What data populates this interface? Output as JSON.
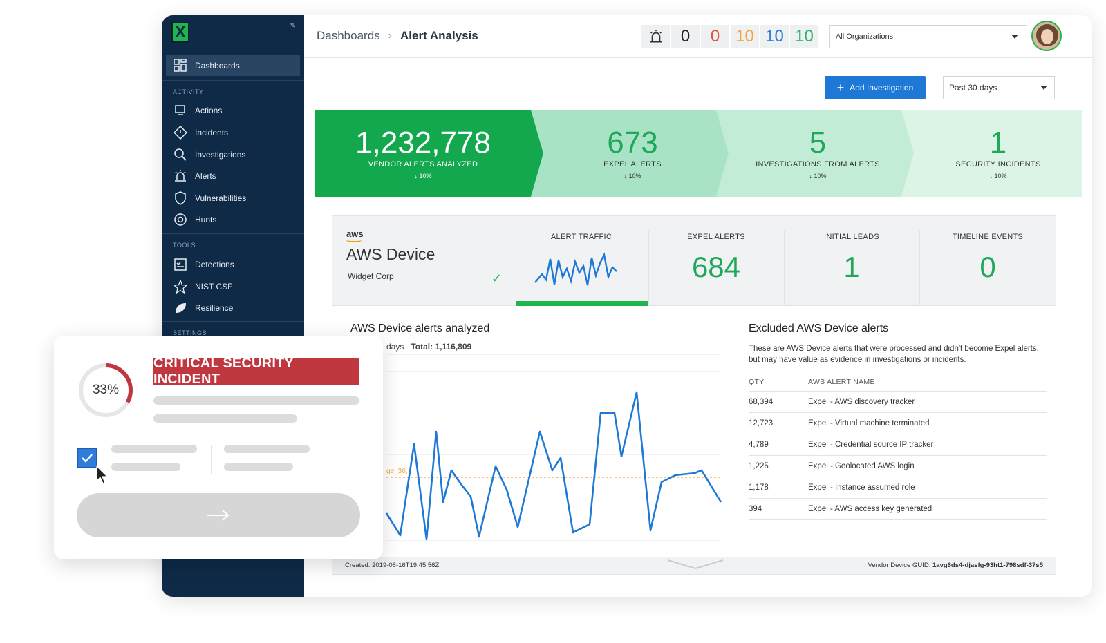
{
  "sidebar": {
    "active_item": {
      "label": "Dashboards",
      "icon": "dashboard-grid-icon"
    },
    "sections": [
      {
        "label": "ACTIVITY",
        "items": [
          {
            "label": "Actions",
            "icon": "actions-icon"
          },
          {
            "label": "Incidents",
            "icon": "incident-diamond-icon"
          },
          {
            "label": "Investigations",
            "icon": "investigations-magnifier-icon"
          },
          {
            "label": "Alerts",
            "icon": "alert-siren-icon"
          },
          {
            "label": "Vulnerabilities",
            "icon": "vulnerability-shield-icon"
          },
          {
            "label": "Hunts",
            "icon": "hunts-target-icon"
          }
        ]
      },
      {
        "label": "TOOLS",
        "items": [
          {
            "label": "Detections",
            "icon": "detections-checklist-icon"
          },
          {
            "label": "NIST CSF",
            "icon": "nist-star-icon"
          },
          {
            "label": "Resilience",
            "icon": "resilience-leaf-icon"
          }
        ]
      },
      {
        "label": "SETTINGS",
        "items": []
      }
    ]
  },
  "header": {
    "breadcrumb": [
      "Dashboards",
      "Alert Analysis"
    ],
    "counters": [
      {
        "value": "0",
        "color": "#222222"
      },
      {
        "value": "0",
        "color": "#e0553b"
      },
      {
        "value": "10",
        "color": "#f0a53a"
      },
      {
        "value": "10",
        "color": "#2d7fd3"
      },
      {
        "value": "10",
        "color": "#2bb36b"
      }
    ],
    "org_select": "All Organizations"
  },
  "toolbar": {
    "add_investigation": "Add Investigation",
    "date_range": "Past 30 days"
  },
  "funnel": [
    {
      "value": "1,232,778",
      "label": "VENDOR ALERTS ANALYZED",
      "change": "10%"
    },
    {
      "value": "673",
      "label": "EXPEL ALERTS",
      "change": "10%"
    },
    {
      "value": "5",
      "label": "INVESTIGATIONS FROM ALERTS",
      "change": "10%"
    },
    {
      "value": "1",
      "label": "SECURITY INCIDENTS",
      "change": "10%"
    }
  ],
  "funnel_colors": [
    "#14a84e",
    "#a7e3c4",
    "#c2ecd6",
    "#dcf4e6"
  ],
  "device": {
    "vendor_logo": "aws",
    "name": "AWS Device",
    "org": "Widget Corp",
    "metrics": [
      {
        "label": "ALERT TRAFFIC"
      },
      {
        "label": "EXPEL ALERTS",
        "value": "684"
      },
      {
        "label": "INITIAL LEADS",
        "value": "1"
      },
      {
        "label": "TIMELINE EVENTS",
        "value": "0"
      }
    ],
    "chart_title": "AWS Device alerts analyzed",
    "chart_sub_partial": "days",
    "chart_total": "Total: 1,116,809",
    "avg_label_partial": "ge: 36,",
    "excluded_title": "Excluded AWS Device alerts",
    "excluded_desc": "These are AWS Device alerts that were processed and didn't become Expel alerts, but may have value as evidence in investigations or incidents.",
    "excluded_headers": [
      "QTY",
      "AWS ALERT NAME"
    ],
    "excluded_rows": [
      {
        "qty": "68,394",
        "name": "Expel - AWS discovery tracker"
      },
      {
        "qty": "12,723",
        "name": "Expel - Virtual machine terminated"
      },
      {
        "qty": "4,789",
        "name": "Expel - Credential source IP tracker"
      },
      {
        "qty": "1,225",
        "name": "Expel - Geolocated AWS login"
      },
      {
        "qty": "1,178",
        "name": "Expel - Instance assumed role"
      },
      {
        "qty": "394",
        "name": "Expel - AWS access key generated"
      }
    ],
    "created": "Created: 2019-08-16T19:45:56Z",
    "guid_label": "Vendor Device GUID:",
    "guid_value": "1avg6ds4-djasfg-93ht1-798sdf-37s5"
  },
  "overlay": {
    "progress_text": "33%",
    "progress_fraction": 0.33,
    "badge": "CRITICAL SECURITY INCIDENT",
    "checkbox_checked": true
  }
}
